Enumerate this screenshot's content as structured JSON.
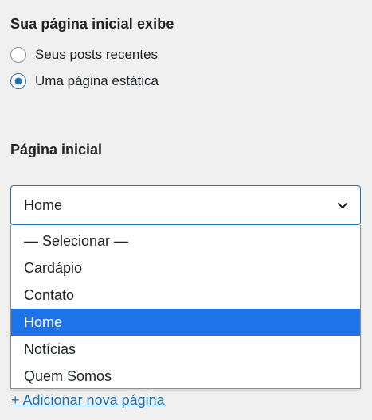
{
  "homepage_display": {
    "title": "Sua página inicial exibe",
    "options": [
      {
        "label": "Seus posts recentes",
        "checked": false
      },
      {
        "label": "Uma página estática",
        "checked": true
      }
    ]
  },
  "homepage_select": {
    "label": "Página inicial",
    "selected_value": "Home",
    "dropdown_options": [
      "— Selecionar —",
      "Cardápio",
      "Contato",
      "Home",
      "Notícias",
      "Quem Somos"
    ],
    "highlighted_index": 3
  },
  "add_page_link": "+ Adicionar nova página",
  "colors": {
    "accent": "#2271b1",
    "highlight": "#1e73e8",
    "background": "#f0f0f1",
    "text": "#1d2327"
  },
  "icons": {
    "select_chevron": "chevron-down-icon"
  }
}
